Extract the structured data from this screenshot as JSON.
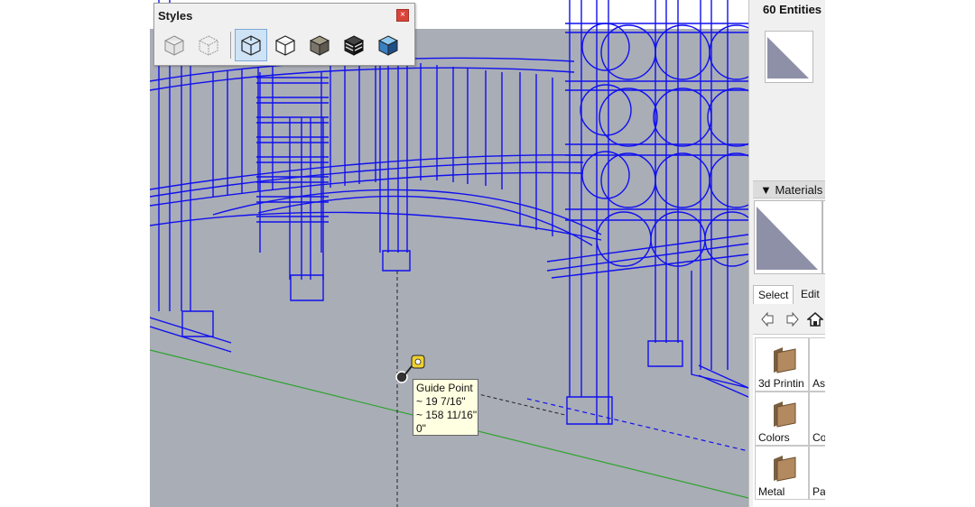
{
  "styles_panel": {
    "title": "Styles",
    "close_glyph": "×",
    "buttons": [
      {
        "icon": "xray-style-icon"
      },
      {
        "icon": "back-edges-style-icon"
      },
      {
        "icon": "wireframe-style-icon",
        "active": true
      },
      {
        "icon": "hidden-line-style-icon"
      },
      {
        "icon": "shaded-style-icon"
      },
      {
        "icon": "shaded-textures-style-icon"
      },
      {
        "icon": "monochrome-style-icon"
      }
    ]
  },
  "viewport": {
    "background": "#a9adb6",
    "wire_color": "#1010ee",
    "axis_green": "#2ea32e",
    "tooltip": {
      "title": "Guide Point",
      "line1": "~ 19 7/16\"",
      "line2": "~ 158 11/16\"",
      "line3": "0\""
    }
  },
  "tray": {
    "entity_info": {
      "header": "60 Entities"
    },
    "materials": {
      "header": "▼ Materials",
      "tabs": {
        "select": "Select",
        "edit": "Edit"
      },
      "nav": {
        "back": "back-arrow-icon",
        "forward": "forward-arrow-icon",
        "home": "home-icon"
      },
      "library": [
        {
          "label": "3d Printin",
          "icon": "folder-icon"
        },
        {
          "label": "As",
          "icon": "folder-icon"
        },
        {
          "label": "Colors",
          "icon": "folder-icon"
        },
        {
          "label": "Co",
          "icon": "folder-icon"
        },
        {
          "label": "Metal",
          "icon": "folder-icon"
        },
        {
          "label": "Pa",
          "icon": "folder-icon"
        }
      ]
    }
  }
}
